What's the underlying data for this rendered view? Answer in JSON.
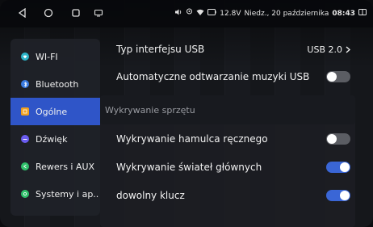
{
  "statusbar": {
    "battery_text": "12.8V",
    "datetime": "Niedz., 20 października",
    "time": "08:43"
  },
  "sidebar": {
    "items": [
      {
        "label": "WI-FI",
        "icon": "wifi-icon",
        "color": "#2db3c8"
      },
      {
        "label": "Bluetooth",
        "icon": "bluetooth-icon",
        "color": "#3a7be0"
      },
      {
        "label": "Ogólne",
        "icon": "general-icon",
        "color": "#f0a020",
        "active": true
      },
      {
        "label": "Dźwięk",
        "icon": "sound-icon",
        "color": "#6a5cf0"
      },
      {
        "label": "Rewers i AUX",
        "icon": "reverse-icon",
        "color": "#2fc06a"
      },
      {
        "label": "Systemy i ap..",
        "icon": "apps-icon",
        "color": "#2fc06a"
      }
    ]
  },
  "settings": {
    "usb_type_label": "Typ interfejsu USB",
    "usb_type_value": "USB 2.0",
    "usb_autoplay_label": "Automatyczne odtwarzanie muzyki USB",
    "usb_autoplay_on": false,
    "hardware_section": "Wykrywanie sprzętu",
    "handbrake_label": "Wykrywanie hamulca ręcznego",
    "handbrake_on": false,
    "headlights_label": "Wykrywanie świateł głównych",
    "headlights_on": true,
    "any_key_label": "dowolny klucz",
    "any_key_on": true
  },
  "colors": {
    "accent": "#2f55c8",
    "toggle_on": "#3a66d6",
    "toggle_off": "#5b5d63"
  }
}
